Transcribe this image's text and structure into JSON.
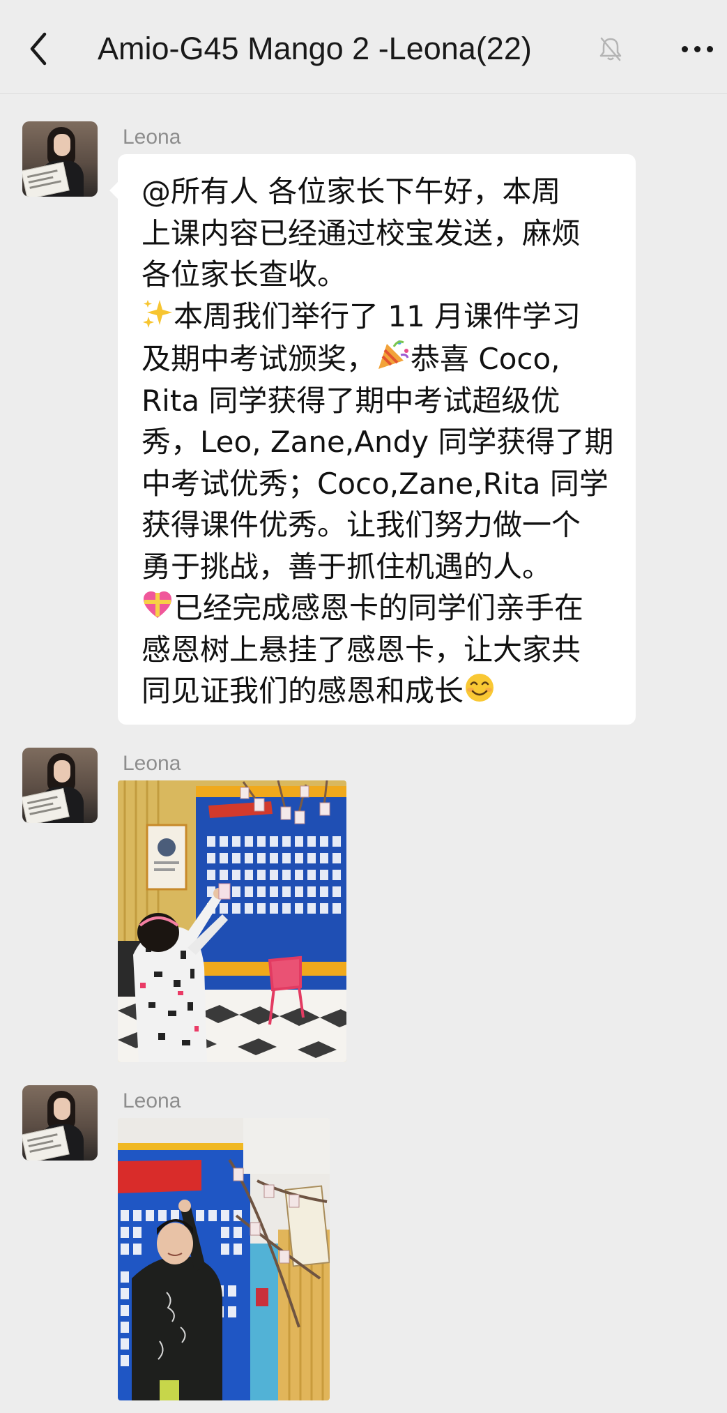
{
  "header": {
    "title": "Amio-G45 Mango 2 -Leona(22)",
    "back_icon": "chevron-left-icon",
    "mute_icon": "bell-off-icon",
    "more_icon": "more-horizontal-icon"
  },
  "messages": [
    {
      "sender": "Leona",
      "type": "text",
      "lines": [
        "@所有人 各位家长下午好，本周",
        "上课内容已经通过校宝发送，麻烦",
        "各位家长查收。",
        "本周我们举行了 11 月课件学习",
        "及期中考试颁奖，",
        "恭喜 Coco,",
        "Rita 同学获得了期中考试超级优",
        "秀，Leo, Zane,Andy 同学获得了期",
        "中考试优秀；Coco,Zane,Rita 同学",
        "获得课件优秀。让我们努力做一个",
        "勇于挑战，善于抓住机遇的人。",
        "已经完成感恩卡的同学们亲手在",
        "感恩树上悬挂了感恩卡，让大家共",
        "同见证我们的感恩和成长"
      ],
      "emojis": [
        "sparkles-icon",
        "party-popper-icon",
        "heart-gift-icon",
        "smiling-face-icon"
      ]
    },
    {
      "sender": "Leona",
      "type": "image",
      "image_desc": "girl-hanging-thanks-card-photo"
    },
    {
      "sender": "Leona",
      "type": "image",
      "image_desc": "boy-by-thanks-tree-photo"
    }
  ],
  "colors": {
    "background": "#ededed",
    "bubble": "#ffffff",
    "sender_name": "#8d8d8d",
    "text": "#111111"
  }
}
